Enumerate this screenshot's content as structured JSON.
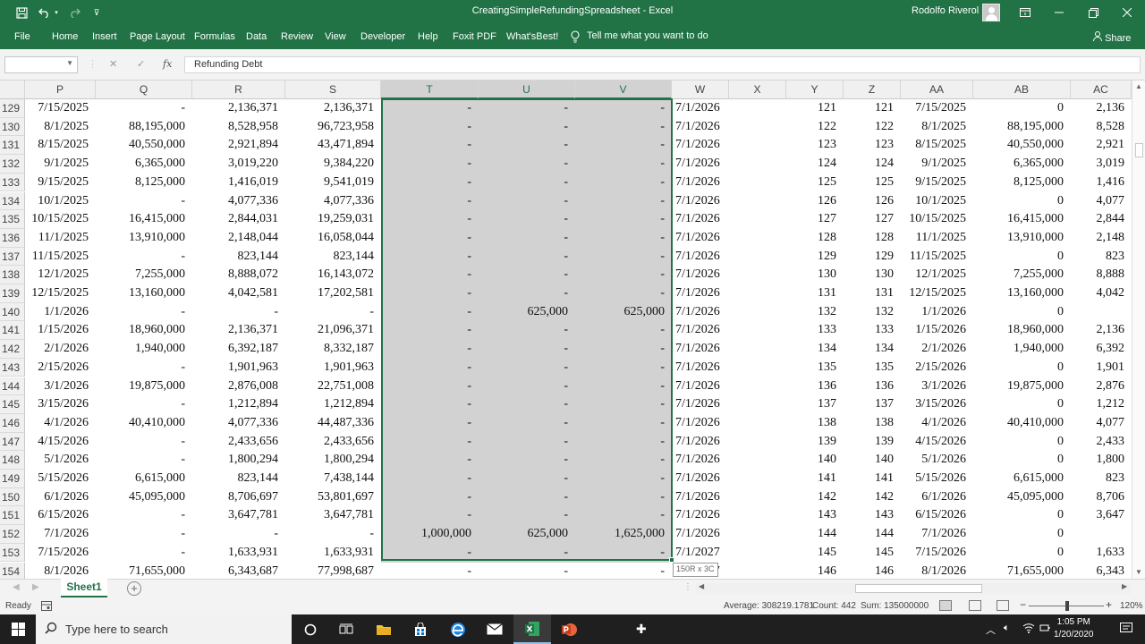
{
  "window": {
    "title": "CreatingSimpleRefundingSpreadsheet  -  Excel",
    "user": "Rodolfo Riverol"
  },
  "ribbon": {
    "tabs": [
      "File",
      "Home",
      "Insert",
      "Page Layout",
      "Formulas",
      "Data",
      "Review",
      "View",
      "Developer",
      "Help",
      "Foxit PDF",
      "What'sBest!"
    ],
    "tell_me": "Tell me what you want to do",
    "share": "Share"
  },
  "formula_bar": {
    "name_box": "",
    "fx_label": "fx",
    "content": "Refunding Debt"
  },
  "grid": {
    "columns": [
      "P",
      "Q",
      "R",
      "S",
      "T",
      "U",
      "V",
      "W",
      "X",
      "Y",
      "Z",
      "AA",
      "AB",
      "AC"
    ],
    "selected_columns": [
      "T",
      "U",
      "V"
    ],
    "rows": [
      {
        "n": "129",
        "P": "7/15/2025",
        "Q": "-",
        "R": "2,136,371",
        "S": "2,136,371",
        "T": "-",
        "U": "-",
        "V": "-",
        "W": "7/1/2026",
        "Y": "121",
        "Z": "121",
        "AA": "7/15/2025",
        "AB": "0",
        "AC": "2,136"
      },
      {
        "n": "130",
        "P": "8/1/2025",
        "Q": "88,195,000",
        "R": "8,528,958",
        "S": "96,723,958",
        "T": "-",
        "U": "-",
        "V": "-",
        "W": "7/1/2026",
        "Y": "122",
        "Z": "122",
        "AA": "8/1/2025",
        "AB": "88,195,000",
        "AC": "8,528"
      },
      {
        "n": "131",
        "P": "8/15/2025",
        "Q": "40,550,000",
        "R": "2,921,894",
        "S": "43,471,894",
        "T": "-",
        "U": "-",
        "V": "-",
        "W": "7/1/2026",
        "Y": "123",
        "Z": "123",
        "AA": "8/15/2025",
        "AB": "40,550,000",
        "AC": "2,921"
      },
      {
        "n": "132",
        "P": "9/1/2025",
        "Q": "6,365,000",
        "R": "3,019,220",
        "S": "9,384,220",
        "T": "-",
        "U": "-",
        "V": "-",
        "W": "7/1/2026",
        "Y": "124",
        "Z": "124",
        "AA": "9/1/2025",
        "AB": "6,365,000",
        "AC": "3,019"
      },
      {
        "n": "133",
        "P": "9/15/2025",
        "Q": "8,125,000",
        "R": "1,416,019",
        "S": "9,541,019",
        "T": "-",
        "U": "-",
        "V": "-",
        "W": "7/1/2026",
        "Y": "125",
        "Z": "125",
        "AA": "9/15/2025",
        "AB": "8,125,000",
        "AC": "1,416"
      },
      {
        "n": "134",
        "P": "10/1/2025",
        "Q": "-",
        "R": "4,077,336",
        "S": "4,077,336",
        "T": "-",
        "U": "-",
        "V": "-",
        "W": "7/1/2026",
        "Y": "126",
        "Z": "126",
        "AA": "10/1/2025",
        "AB": "0",
        "AC": "4,077"
      },
      {
        "n": "135",
        "P": "10/15/2025",
        "Q": "16,415,000",
        "R": "2,844,031",
        "S": "19,259,031",
        "T": "-",
        "U": "-",
        "V": "-",
        "W": "7/1/2026",
        "Y": "127",
        "Z": "127",
        "AA": "10/15/2025",
        "AB": "16,415,000",
        "AC": "2,844"
      },
      {
        "n": "136",
        "P": "11/1/2025",
        "Q": "13,910,000",
        "R": "2,148,044",
        "S": "16,058,044",
        "T": "-",
        "U": "-",
        "V": "-",
        "W": "7/1/2026",
        "Y": "128",
        "Z": "128",
        "AA": "11/1/2025",
        "AB": "13,910,000",
        "AC": "2,148"
      },
      {
        "n": "137",
        "P": "11/15/2025",
        "Q": "-",
        "R": "823,144",
        "S": "823,144",
        "T": "-",
        "U": "-",
        "V": "-",
        "W": "7/1/2026",
        "Y": "129",
        "Z": "129",
        "AA": "11/15/2025",
        "AB": "0",
        "AC": "823"
      },
      {
        "n": "138",
        "P": "12/1/2025",
        "Q": "7,255,000",
        "R": "8,888,072",
        "S": "16,143,072",
        "T": "-",
        "U": "-",
        "V": "-",
        "W": "7/1/2026",
        "Y": "130",
        "Z": "130",
        "AA": "12/1/2025",
        "AB": "7,255,000",
        "AC": "8,888"
      },
      {
        "n": "139",
        "P": "12/15/2025",
        "Q": "13,160,000",
        "R": "4,042,581",
        "S": "17,202,581",
        "T": "-",
        "U": "-",
        "V": "-",
        "W": "7/1/2026",
        "Y": "131",
        "Z": "131",
        "AA": "12/15/2025",
        "AB": "13,160,000",
        "AC": "4,042"
      },
      {
        "n": "140",
        "P": "1/1/2026",
        "Q": "-",
        "R": "-",
        "S": "-",
        "T": "-",
        "U": "625,000",
        "V": "625,000",
        "W": "7/1/2026",
        "Y": "132",
        "Z": "132",
        "AA": "1/1/2026",
        "AB": "0",
        "AC": ""
      },
      {
        "n": "141",
        "P": "1/15/2026",
        "Q": "18,960,000",
        "R": "2,136,371",
        "S": "21,096,371",
        "T": "-",
        "U": "-",
        "V": "-",
        "W": "7/1/2026",
        "Y": "133",
        "Z": "133",
        "AA": "1/15/2026",
        "AB": "18,960,000",
        "AC": "2,136"
      },
      {
        "n": "142",
        "P": "2/1/2026",
        "Q": "1,940,000",
        "R": "6,392,187",
        "S": "8,332,187",
        "T": "-",
        "U": "-",
        "V": "-",
        "W": "7/1/2026",
        "Y": "134",
        "Z": "134",
        "AA": "2/1/2026",
        "AB": "1,940,000",
        "AC": "6,392"
      },
      {
        "n": "143",
        "P": "2/15/2026",
        "Q": "-",
        "R": "1,901,963",
        "S": "1,901,963",
        "T": "-",
        "U": "-",
        "V": "-",
        "W": "7/1/2026",
        "Y": "135",
        "Z": "135",
        "AA": "2/15/2026",
        "AB": "0",
        "AC": "1,901"
      },
      {
        "n": "144",
        "P": "3/1/2026",
        "Q": "19,875,000",
        "R": "2,876,008",
        "S": "22,751,008",
        "T": "-",
        "U": "-",
        "V": "-",
        "W": "7/1/2026",
        "Y": "136",
        "Z": "136",
        "AA": "3/1/2026",
        "AB": "19,875,000",
        "AC": "2,876"
      },
      {
        "n": "145",
        "P": "3/15/2026",
        "Q": "-",
        "R": "1,212,894",
        "S": "1,212,894",
        "T": "-",
        "U": "-",
        "V": "-",
        "W": "7/1/2026",
        "Y": "137",
        "Z": "137",
        "AA": "3/15/2026",
        "AB": "0",
        "AC": "1,212"
      },
      {
        "n": "146",
        "P": "4/1/2026",
        "Q": "40,410,000",
        "R": "4,077,336",
        "S": "44,487,336",
        "T": "-",
        "U": "-",
        "V": "-",
        "W": "7/1/2026",
        "Y": "138",
        "Z": "138",
        "AA": "4/1/2026",
        "AB": "40,410,000",
        "AC": "4,077"
      },
      {
        "n": "147",
        "P": "4/15/2026",
        "Q": "-",
        "R": "2,433,656",
        "S": "2,433,656",
        "T": "-",
        "U": "-",
        "V": "-",
        "W": "7/1/2026",
        "Y": "139",
        "Z": "139",
        "AA": "4/15/2026",
        "AB": "0",
        "AC": "2,433"
      },
      {
        "n": "148",
        "P": "5/1/2026",
        "Q": "-",
        "R": "1,800,294",
        "S": "1,800,294",
        "T": "-",
        "U": "-",
        "V": "-",
        "W": "7/1/2026",
        "Y": "140",
        "Z": "140",
        "AA": "5/1/2026",
        "AB": "0",
        "AC": "1,800"
      },
      {
        "n": "149",
        "P": "5/15/2026",
        "Q": "6,615,000",
        "R": "823,144",
        "S": "7,438,144",
        "T": "-",
        "U": "-",
        "V": "-",
        "W": "7/1/2026",
        "Y": "141",
        "Z": "141",
        "AA": "5/15/2026",
        "AB": "6,615,000",
        "AC": "823"
      },
      {
        "n": "150",
        "P": "6/1/2026",
        "Q": "45,095,000",
        "R": "8,706,697",
        "S": "53,801,697",
        "T": "-",
        "U": "-",
        "V": "-",
        "W": "7/1/2026",
        "Y": "142",
        "Z": "142",
        "AA": "6/1/2026",
        "AB": "45,095,000",
        "AC": "8,706"
      },
      {
        "n": "151",
        "P": "6/15/2026",
        "Q": "-",
        "R": "3,647,781",
        "S": "3,647,781",
        "T": "-",
        "U": "-",
        "V": "-",
        "W": "7/1/2026",
        "Y": "143",
        "Z": "143",
        "AA": "6/15/2026",
        "AB": "0",
        "AC": "3,647"
      },
      {
        "n": "152",
        "P": "7/1/2026",
        "Q": "-",
        "R": "-",
        "S": "-",
        "T": "1,000,000",
        "U": "625,000",
        "V": "1,625,000",
        "W": "7/1/2026",
        "Y": "144",
        "Z": "144",
        "AA": "7/1/2026",
        "AB": "0",
        "AC": ""
      },
      {
        "n": "153",
        "P": "7/15/2026",
        "Q": "-",
        "R": "1,633,931",
        "S": "1,633,931",
        "T": "-",
        "U": "-",
        "V": "-",
        "W": "7/1/2027",
        "Y": "145",
        "Z": "145",
        "AA": "7/15/2026",
        "AB": "0",
        "AC": "1,633"
      },
      {
        "n": "154",
        "P": "8/1/2026",
        "Q": "71,655,000",
        "R": "6,343,687",
        "S": "77,998,687",
        "T": "-",
        "U": "-",
        "V": "-",
        "W": "7/1/2027",
        "Y": "146",
        "Z": "146",
        "AA": "8/1/2026",
        "AB": "71,655,000",
        "AC": "6,343"
      }
    ],
    "selection_tooltip": "150R x 3C"
  },
  "sheets": {
    "tabs": [
      "Sheet1"
    ],
    "add_label": "+"
  },
  "status": {
    "ready": "Ready",
    "average": "Average: 308219.1781",
    "count": "Count: 442",
    "sum": "Sum: 135000000",
    "zoom": "120%",
    "zoom_minus": "−",
    "zoom_plus": "+"
  },
  "taskbar": {
    "search_placeholder": "Type here to search",
    "time": "1:05 PM",
    "date": "1/20/2020"
  },
  "colors": {
    "excel_green": "#217346",
    "selection_fill": "#d2d2d2",
    "taskbar": "#1f1f1f"
  },
  "icons": [
    "save-icon",
    "undo-icon",
    "redo-icon",
    "customize-qa-icon",
    "ribbon-display-icon",
    "minimize-icon",
    "maximize-icon",
    "close-icon",
    "lightbulb-icon",
    "share-person-icon",
    "cancel-icon",
    "enter-icon",
    "fx-icon",
    "windows-logo-icon",
    "search-icon",
    "cortana-icon",
    "task-view-icon",
    "file-explorer-icon",
    "store-icon",
    "edge-icon",
    "mail-icon",
    "excel-icon",
    "powerpoint-icon"
  ]
}
